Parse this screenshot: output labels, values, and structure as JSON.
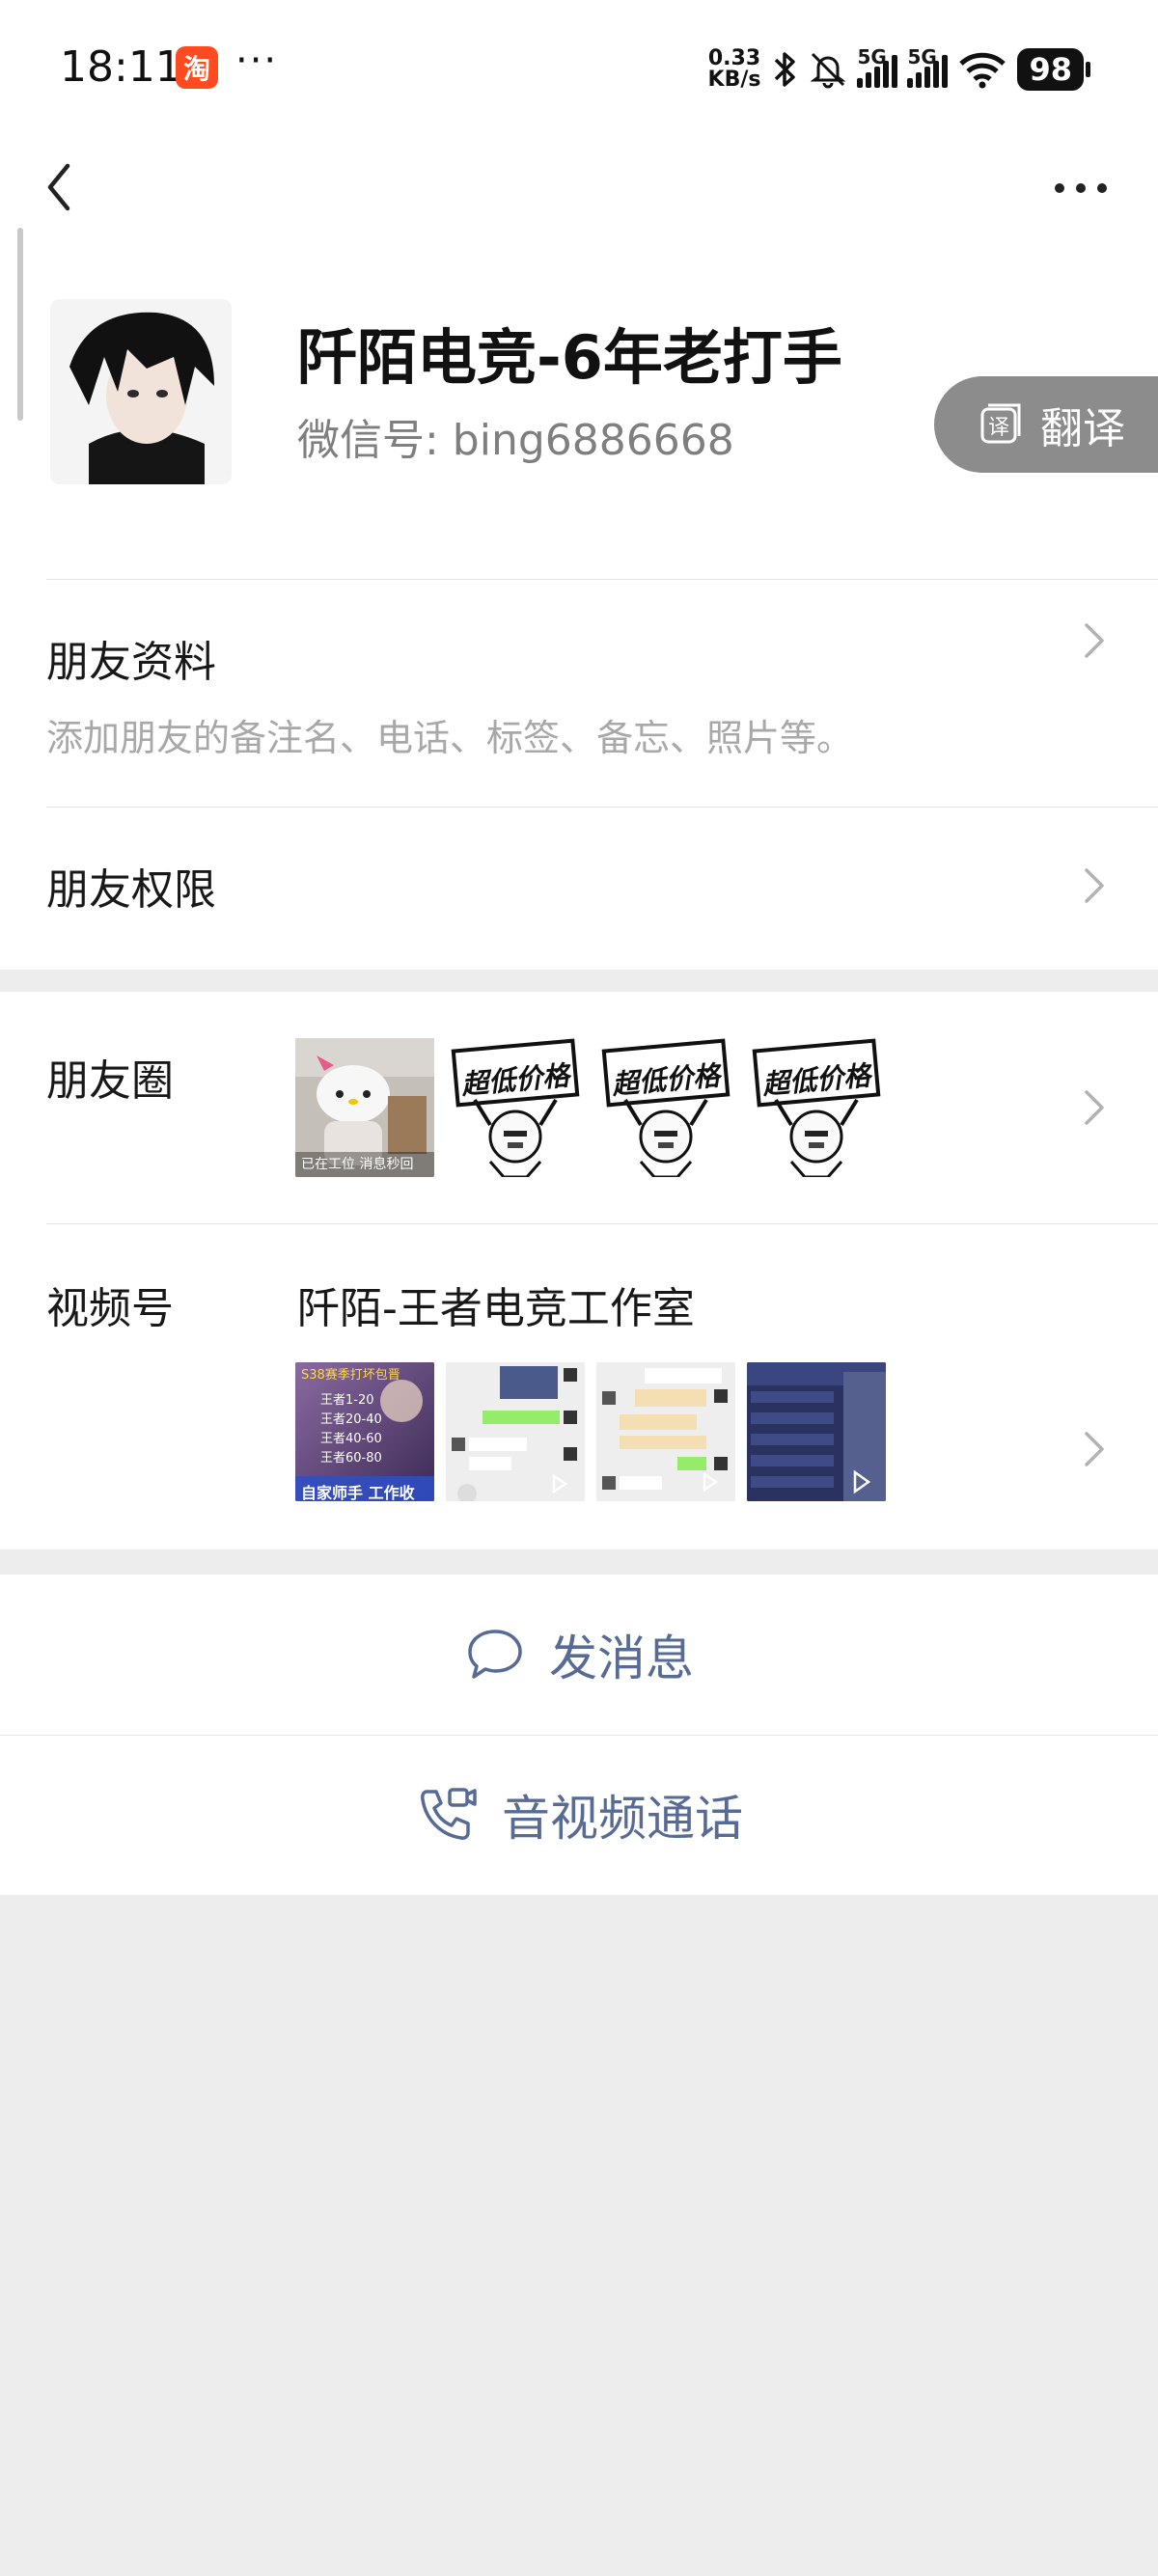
{
  "status_bar": {
    "time": "18:11",
    "app_badge": "淘",
    "more": "···",
    "speed_value": "0.33",
    "speed_unit": "KB/s",
    "sim1": "5G",
    "sim2": "5G",
    "battery": "98"
  },
  "profile": {
    "nickname": "阡陌电竞-6年老打手",
    "wechat_id": "微信号:  bing6886668",
    "translate_label": "翻译"
  },
  "rows": {
    "friend_info_title": "朋友资料",
    "friend_info_subtitle": "添加朋友的备注名、电话、标签、备忘、照片等。",
    "friend_permission_title": "朋友权限",
    "moments_title": "朋友圈",
    "channels_title": "视频号",
    "channels_name": "阡陌-王者电竞工作室"
  },
  "moments_thumbs": {
    "thumb1_caption": "已在工位 消息秒回",
    "meme_text": "超低价格"
  },
  "channels_thumbs": {
    "thumb1_title": "S38赛季打坏包晋",
    "thumb1_lines": [
      "王者1-20",
      "王者20-40",
      "王者40-60",
      "王者60-80"
    ],
    "thumb1_footer": "自家师手 工作收"
  },
  "actions": {
    "message": "发消息",
    "call": "音视频通话"
  },
  "colors": {
    "link_blue": "#576b95",
    "background": "#ededed"
  }
}
